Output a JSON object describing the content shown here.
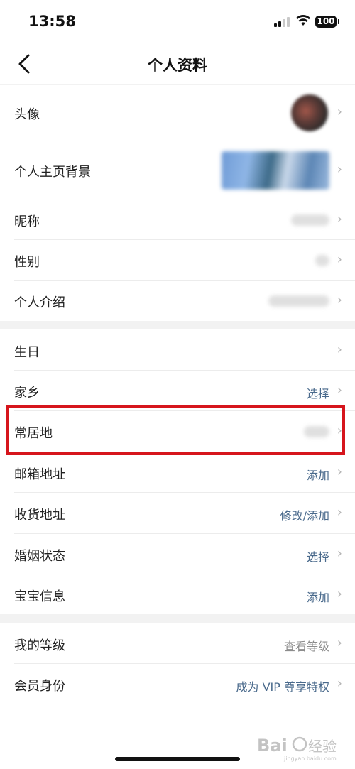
{
  "status_bar": {
    "time": "13:58",
    "battery": "100"
  },
  "nav": {
    "title": "个人资料"
  },
  "section1": [
    {
      "label": "头像"
    },
    {
      "label": "个人主页背景"
    },
    {
      "label": "昵称"
    },
    {
      "label": "性别"
    },
    {
      "label": "个人介绍"
    }
  ],
  "section2": [
    {
      "label": "生日",
      "value": ""
    },
    {
      "label": "家乡",
      "value": "选择"
    },
    {
      "label": "常居地",
      "value": ""
    },
    {
      "label": "邮箱地址",
      "value": "添加"
    },
    {
      "label": "收货地址",
      "value": "修改/添加"
    },
    {
      "label": "婚姻状态",
      "value": "选择"
    },
    {
      "label": "宝宝信息",
      "value": "添加"
    }
  ],
  "section3": [
    {
      "label": "我的等级",
      "value": "查看等级"
    },
    {
      "label": "会员身份",
      "value": "成为 VIP 尊享特权"
    }
  ],
  "icons": {
    "back": "back-arrow-icon",
    "chevron": "chevron-right-icon"
  },
  "watermark": "Bai 经验"
}
